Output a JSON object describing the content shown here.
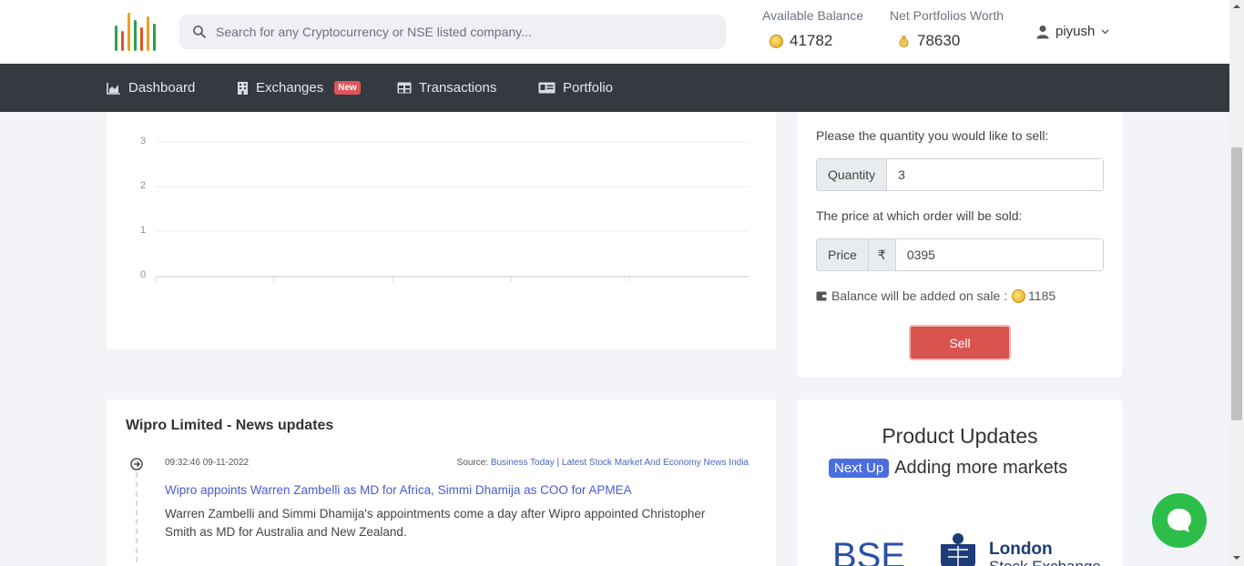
{
  "header": {
    "search_placeholder": "Search for any Cryptocurrency or NSE listed company...",
    "available_balance_label": "Available Balance",
    "available_balance_value": "41782",
    "net_worth_label": "Net Portfolios Worth",
    "net_worth_value": "78630",
    "username": "piyush"
  },
  "nav": {
    "items": [
      {
        "label": "Dashboard",
        "icon": "chart-area-icon"
      },
      {
        "label": "Exchanges",
        "icon": "building-icon",
        "badge": "New"
      },
      {
        "label": "Transactions",
        "icon": "table-icon"
      },
      {
        "label": "Portfolio",
        "icon": "id-card-icon"
      }
    ]
  },
  "chart": {
    "yticks": [
      "3",
      "2",
      "1",
      "0"
    ],
    "gridline_color": "#eeeeee"
  },
  "sell": {
    "quantity_prompt": "Please the quantity you would like to sell:",
    "quantity_label": "Quantity",
    "quantity_value": "3",
    "price_prompt": "The price at which order will be sold:",
    "price_label": "Price",
    "currency_symbol": "₹",
    "price_value": "0395",
    "balance_note": "Balance will be added on sale :",
    "balance_added": "1185",
    "sell_button": "Sell",
    "button_color": "#d9534f"
  },
  "news": {
    "title": "Wipro Limited - News updates",
    "items": [
      {
        "time": "09:32:46 09-11-2022",
        "source_prefix": "Source:",
        "source": "Business Today | Latest Stock Market And Economy News India",
        "headline": "Wipro appoints Warren Zambelli as MD for Africa, Simmi Dhamija as COO for APMEA",
        "summary": "Warren Zambelli and Simmi Dhamija's appointments come a day after Wipro appointed Christopher Smith as MD for Australia and New Zealand."
      }
    ]
  },
  "updates": {
    "title": "Product Updates",
    "pill": "Next Up",
    "text": "Adding more markets",
    "logos": {
      "bse": "BSE",
      "lse_line1": "London",
      "lse_line2": "Stock Exchange"
    }
  },
  "colors": {
    "navbar": "#343a40",
    "accent": "#4a6ee0",
    "chat": "#2dbe4a"
  }
}
